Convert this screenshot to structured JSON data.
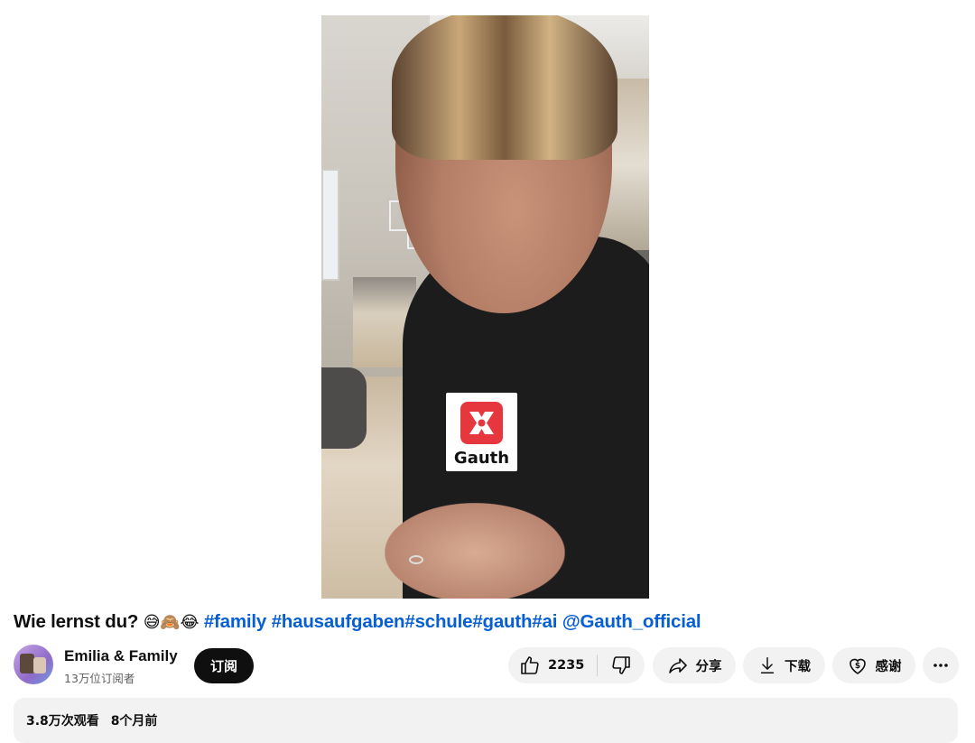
{
  "video": {
    "overlay_logo_text": "Gauth",
    "colors": {
      "logo_red": "#e5373d"
    }
  },
  "title": {
    "text": "Wie lernst du?",
    "emojis": "😅🙈😂",
    "hashtags": "#family #hausaufgaben#schule#gauth#ai",
    "mention": "@Gauth_official",
    "link_color": "#065fd4"
  },
  "channel": {
    "name": "Emilia & Family",
    "subscribers": "13万位订阅者",
    "subscribe_label": "订阅"
  },
  "actions": {
    "like_count": "2235",
    "share_label": "分享",
    "download_label": "下载",
    "thanks_label": "感谢",
    "icons": [
      "thumbs-up-icon",
      "thumbs-down-icon",
      "share-icon",
      "download-icon",
      "thanks-icon",
      "more-icon"
    ]
  },
  "description": {
    "views": "3.8万次观看",
    "age": "8个月前"
  }
}
